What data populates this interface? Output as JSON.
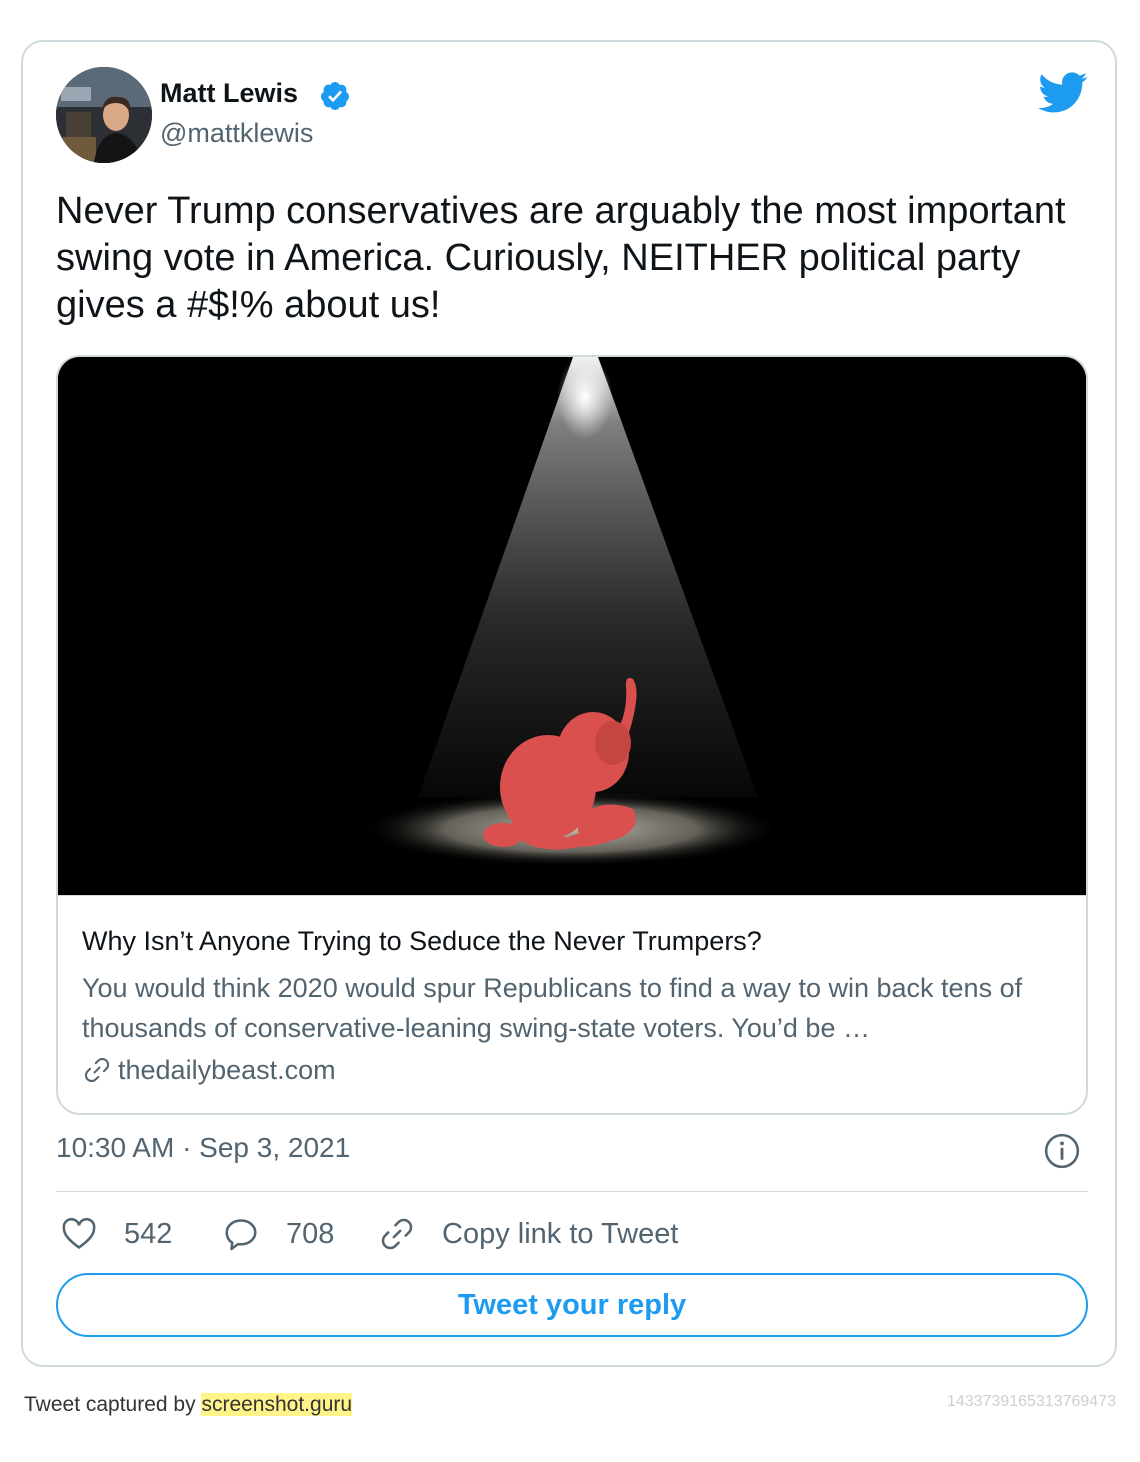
{
  "author": {
    "name": "Matt Lewis",
    "handle": "@mattklewis",
    "verified": true,
    "avatar_icon": "profile-photo"
  },
  "brand": {
    "icon": "twitter-bird-icon",
    "color": "#1d9bf0"
  },
  "tweet": {
    "text": "Never Trump conservatives are arguably the most important swing vote in America. Curiously, NEITHER political party gives a #$!% about us!"
  },
  "link_card": {
    "image": "red elephant sitting under a spotlight on black background",
    "title": "Why Isn’t Anyone Trying to Seduce the Never Trumpers?",
    "description": "You would think 2020 would spur Republicans to find a way to win back tens of thousands of conservative-leaning swing-state voters. You’d be …",
    "domain": "thedailybeast.com"
  },
  "meta": {
    "timestamp": "10:30 AM · Sep 3, 2021"
  },
  "actions": {
    "likes": "542",
    "replies": "708",
    "copy_link": "Copy link to Tweet"
  },
  "reply_button": "Tweet your reply",
  "footer": {
    "prefix": "Tweet captured by",
    "site": "screenshot.guru",
    "tweet_id": "1433739165313769473"
  },
  "colors": {
    "accent": "#1d9bf0",
    "secondary_text": "#536471",
    "border": "#cfd9de",
    "elephant": "#d9504e"
  }
}
